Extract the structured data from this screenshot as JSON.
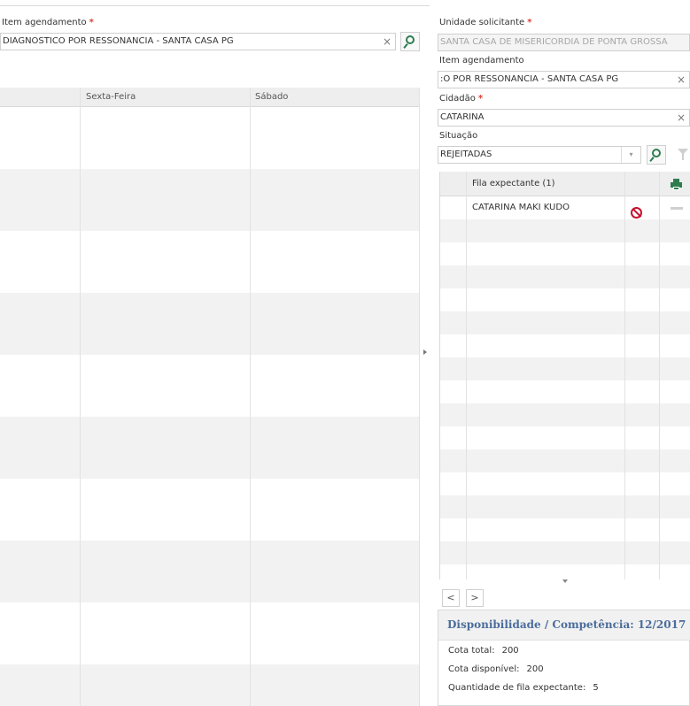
{
  "left_form": {
    "item_label": "Item agendamento",
    "required_mark": "*",
    "item_value": "DIAGNOSTICO POR RESSONANCIA - SANTA CASA PG",
    "clear_glyph": "×"
  },
  "calendar": {
    "columns": [
      "Sexta-Feira",
      "Sábado"
    ]
  },
  "right_form": {
    "unidade_label": "Unidade solicitante",
    "unidade_value": "SANTA CASA DE MISERICORDIA DE PONTA GROSSA",
    "item_label": "Item agendamento",
    "item_value": ":O POR RESSONANCIA - SANTA CASA PG",
    "cidadao_label": "Cidadão",
    "cidadao_value": "CATARINA",
    "situacao_label": "Situação",
    "situacao_value": "REJEITADAS",
    "dropdown_glyph": "▾"
  },
  "queue": {
    "header": "Fila expectante (1)",
    "rows": [
      {
        "name": "CATARINA  MAKI KUDO"
      }
    ]
  },
  "pager": {
    "prev": "<",
    "next": ">"
  },
  "availability": {
    "title": "Disponibilidade / Competência: 12/2017",
    "cota_total_label": "Cota total:",
    "cota_total": "200",
    "cota_disp_label": "Cota disponível:",
    "cota_disp": "200",
    "fila_label": "Quantidade de fila expectante:",
    "fila_qtd": "5"
  },
  "colors": {
    "accent_green": "#2e7d4f",
    "required_red": "#e03c31",
    "title_blue": "#4a6d9c",
    "ban_red": "#c8102e"
  },
  "icons": [
    "search-icon",
    "clear-icon",
    "dropdown-icon",
    "filter-icon",
    "print-icon",
    "ban-icon",
    "remove-icon",
    "chevron-left-icon",
    "chevron-right-icon"
  ]
}
